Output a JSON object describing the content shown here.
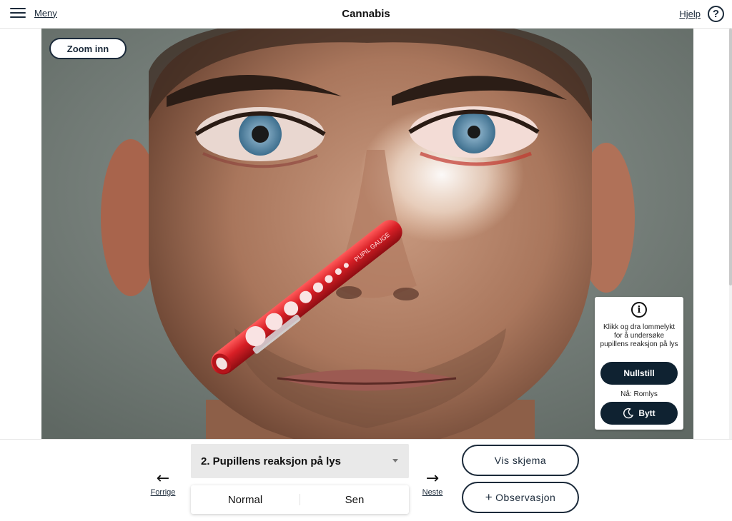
{
  "header": {
    "menu_label": "Meny",
    "title": "Cannabis",
    "help_label": "Hjelp",
    "help_icon": "?"
  },
  "scene": {
    "zoom_label": "Zoom inn",
    "penlight_text": "PUPIL GAUGE"
  },
  "info_panel": {
    "icon": "i",
    "instruction": "Klikk og dra lommelykt for å undersøke pupillens reaksjon på lys",
    "reset_label": "Nullstill",
    "current_state": "Nå: Romlys",
    "switch_label": "Bytt",
    "switch_icon": "moon-icon"
  },
  "navigation": {
    "prev_label": "Forrige",
    "next_label": "Neste",
    "prev_arrow": "←",
    "next_arrow": "→"
  },
  "step_select": {
    "selected": "2. Pupillens reaksjon på lys",
    "options": [
      "Normal",
      "Sen"
    ]
  },
  "actions": {
    "schema_label": "Vis skjema",
    "observation_label": "Observasjon",
    "observation_icon": "+"
  },
  "colors": {
    "navy": "#0f2231",
    "penlight_red": "#d81f26"
  }
}
